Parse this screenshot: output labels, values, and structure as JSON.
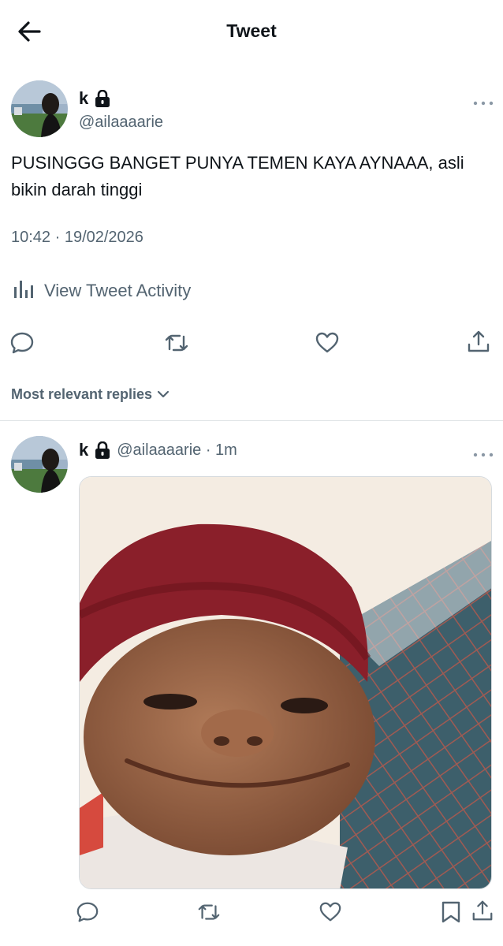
{
  "header": {
    "title": "Tweet",
    "back_icon": "arrow-left-icon"
  },
  "tweet": {
    "author_name": "k",
    "handle": "@ailaaaarie",
    "text": "PUSINGGG BANGET PUNYA TEMEN KAYA AYNAAA, asli bikin darah tinggi",
    "timestamp": "10:42 · 19/02/2026",
    "activity_label": "View Tweet Activity"
  },
  "replies_sort": {
    "label": "Most relevant replies"
  },
  "reply": {
    "author_name": "k",
    "meta": "@ailaaaarie · 1m"
  },
  "colors": {
    "text": "#0f1419",
    "secondary": "#536471",
    "divider": "#e1e5e8"
  }
}
